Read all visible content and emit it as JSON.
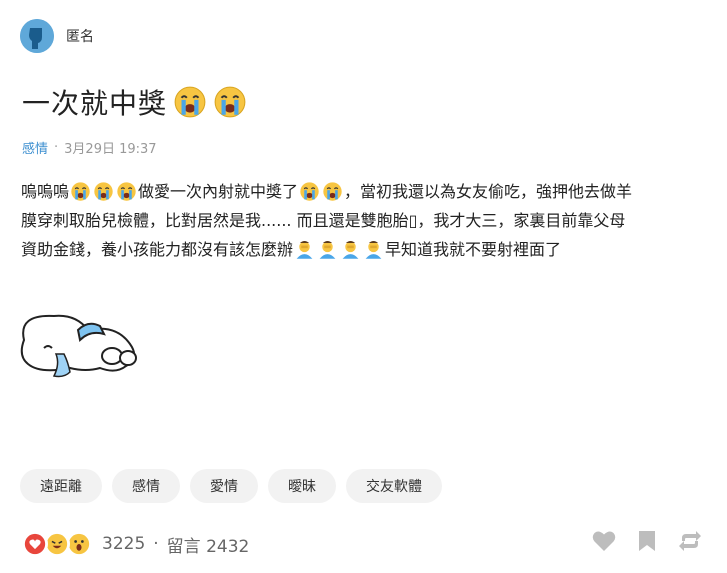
{
  "author": {
    "name": "匿名",
    "avatar_icon": "anonymous-user-icon"
  },
  "post": {
    "title": "一次就中獎",
    "board": "感情",
    "separator": "·",
    "datetime": "3月29日 19:37",
    "body": {
      "l1_a": "嗚嗚嗚",
      "l1_b": "做愛一次內射就中獎了",
      "l1_c": "，當初我還以為女友偷吃，強押他去做羊",
      "l2": "膜穿刺取胎兒檢體，比對居然是我...... 而且還是雙胞胎▯，我才大三，家裏目前靠父母",
      "l3_a": "資助金錢，養小孩能力都沒有該怎麼辦",
      "l3_b": "早知道我就不要射裡面了"
    }
  },
  "tags": [
    "遠距離",
    "感情",
    "愛情",
    "曖昧",
    "交友軟體"
  ],
  "footer": {
    "reaction_count": "3225",
    "separator": "·",
    "comment_label": "留言 2432"
  },
  "colors": {
    "accent": "#3d8fd0",
    "tag_bg": "#f2f2f2",
    "heart": "#e8463c",
    "emoji": "#f7c542",
    "tear": "#4aa6e8"
  }
}
